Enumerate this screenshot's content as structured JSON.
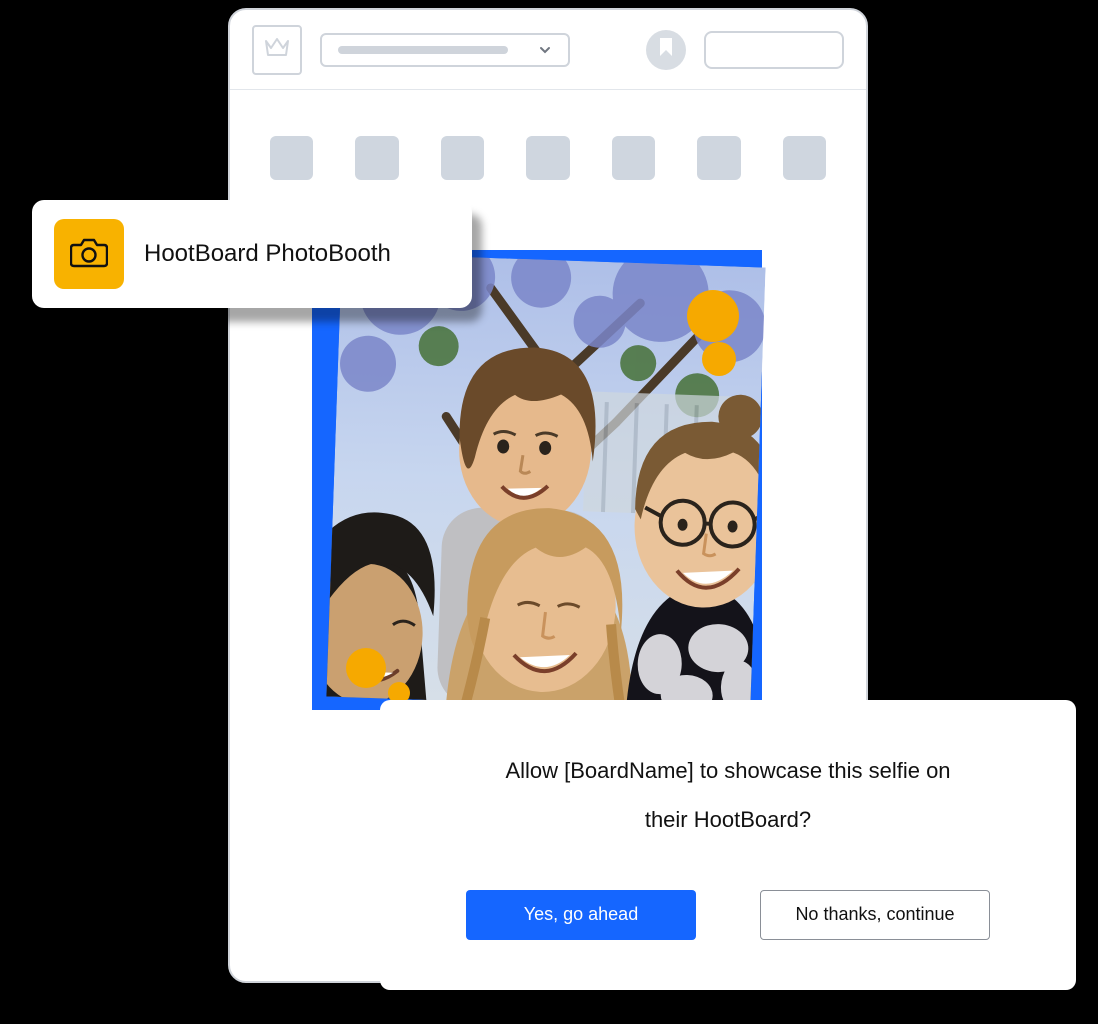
{
  "photobooth_card": {
    "title": "HootBoard PhotoBooth",
    "icon_name": "camera-icon"
  },
  "modal": {
    "line1": "Allow [BoardName] to showcase this selfie on",
    "line2": "their HootBoard?",
    "primary_label": "Yes, go ahead",
    "secondary_label": "No thanks, continue"
  },
  "header": {
    "logo_icon": "crown-icon",
    "bookmark_icon": "bookmark-icon",
    "chevron_icon": "chevron-down-icon"
  },
  "colors": {
    "brand_yellow": "#f8b200",
    "accent_blue": "#1566ff",
    "placeholder_grey": "#cfd6df"
  },
  "app_grid": {
    "count": 7
  },
  "photo": {
    "bubbles": 4
  }
}
